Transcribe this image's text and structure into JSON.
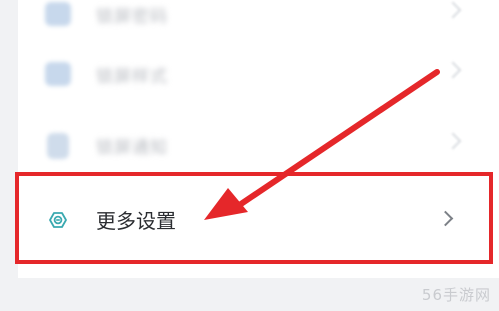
{
  "settings_list": {
    "rows": [
      {
        "label": "锁屏密码",
        "icon": "lock-icon"
      },
      {
        "label": "锁屏样式",
        "icon": "wallpaper-icon"
      },
      {
        "label": "锁屏通知",
        "icon": "notification-icon"
      },
      {
        "label": "更多设置",
        "icon": "gear-icon"
      }
    ]
  },
  "colors": {
    "highlight": "#e5272a",
    "icon_teal": "#3aa9b0"
  },
  "watermark": "56手游网"
}
